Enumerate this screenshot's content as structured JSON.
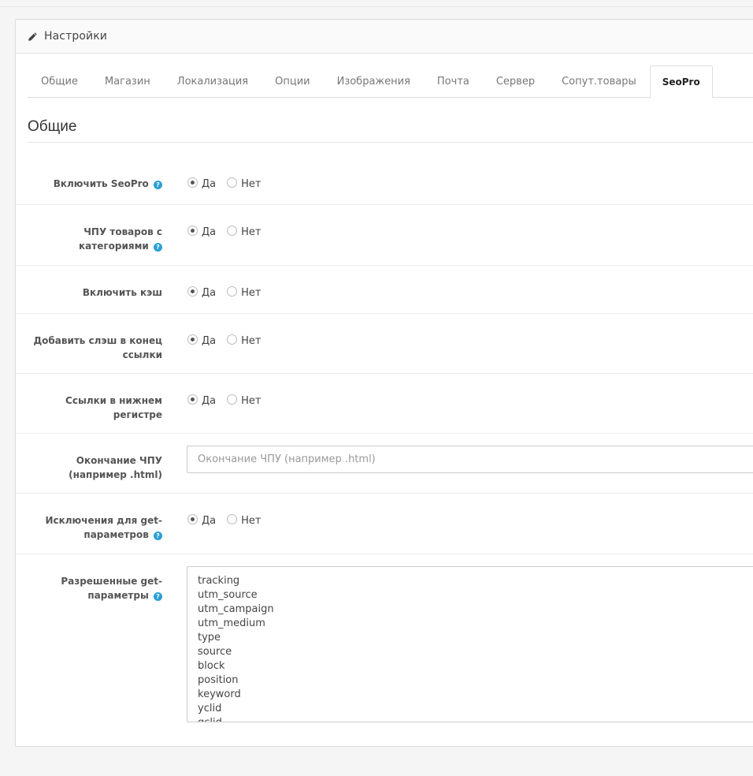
{
  "panel": {
    "title": "Настройки"
  },
  "tabs": [
    "Общие",
    "Магазин",
    "Локализация",
    "Опции",
    "Изображения",
    "Почта",
    "Сервер",
    "Сопут.товары",
    "SeoPro"
  ],
  "active_tab": "SeoPro",
  "section": {
    "title": "Общие"
  },
  "radio_labels": {
    "yes": "Да",
    "no": "Нет"
  },
  "fields": {
    "enable_seopro": {
      "label": "Включить SeoPro",
      "value": "Да",
      "help": true
    },
    "product_category_urls": {
      "label_line1": "ЧПУ товаров с",
      "label_line2": "категориями",
      "value": "Да",
      "help": true
    },
    "enable_cache": {
      "label": "Включить кэш",
      "value": "Да"
    },
    "trailing_slash": {
      "label_line1": "Добавить слэш в конец",
      "label_line2": "ссылки",
      "value": "Да"
    },
    "lowercase_links": {
      "label_line1": "Ссылки в нижнем",
      "label_line2": "регистре",
      "value": "Да"
    },
    "url_suffix": {
      "label_line1": "Окончание ЧПУ",
      "label_line2": "(например .html)",
      "value": "",
      "placeholder": "Окончание ЧПУ (например .html)"
    },
    "get_exceptions": {
      "label_line1": "Исключения для get-",
      "label_line2": "параметров",
      "value": "Да",
      "help": true
    },
    "allowed_get_params": {
      "label_line1": "Разрешенные get-",
      "label_line2": "параметры",
      "help": true,
      "lines": [
        "tracking",
        "utm_source",
        "utm_campaign",
        "utm_medium",
        "type",
        "source",
        "block",
        "position",
        "keyword",
        "yclid",
        "gclid"
      ]
    }
  }
}
